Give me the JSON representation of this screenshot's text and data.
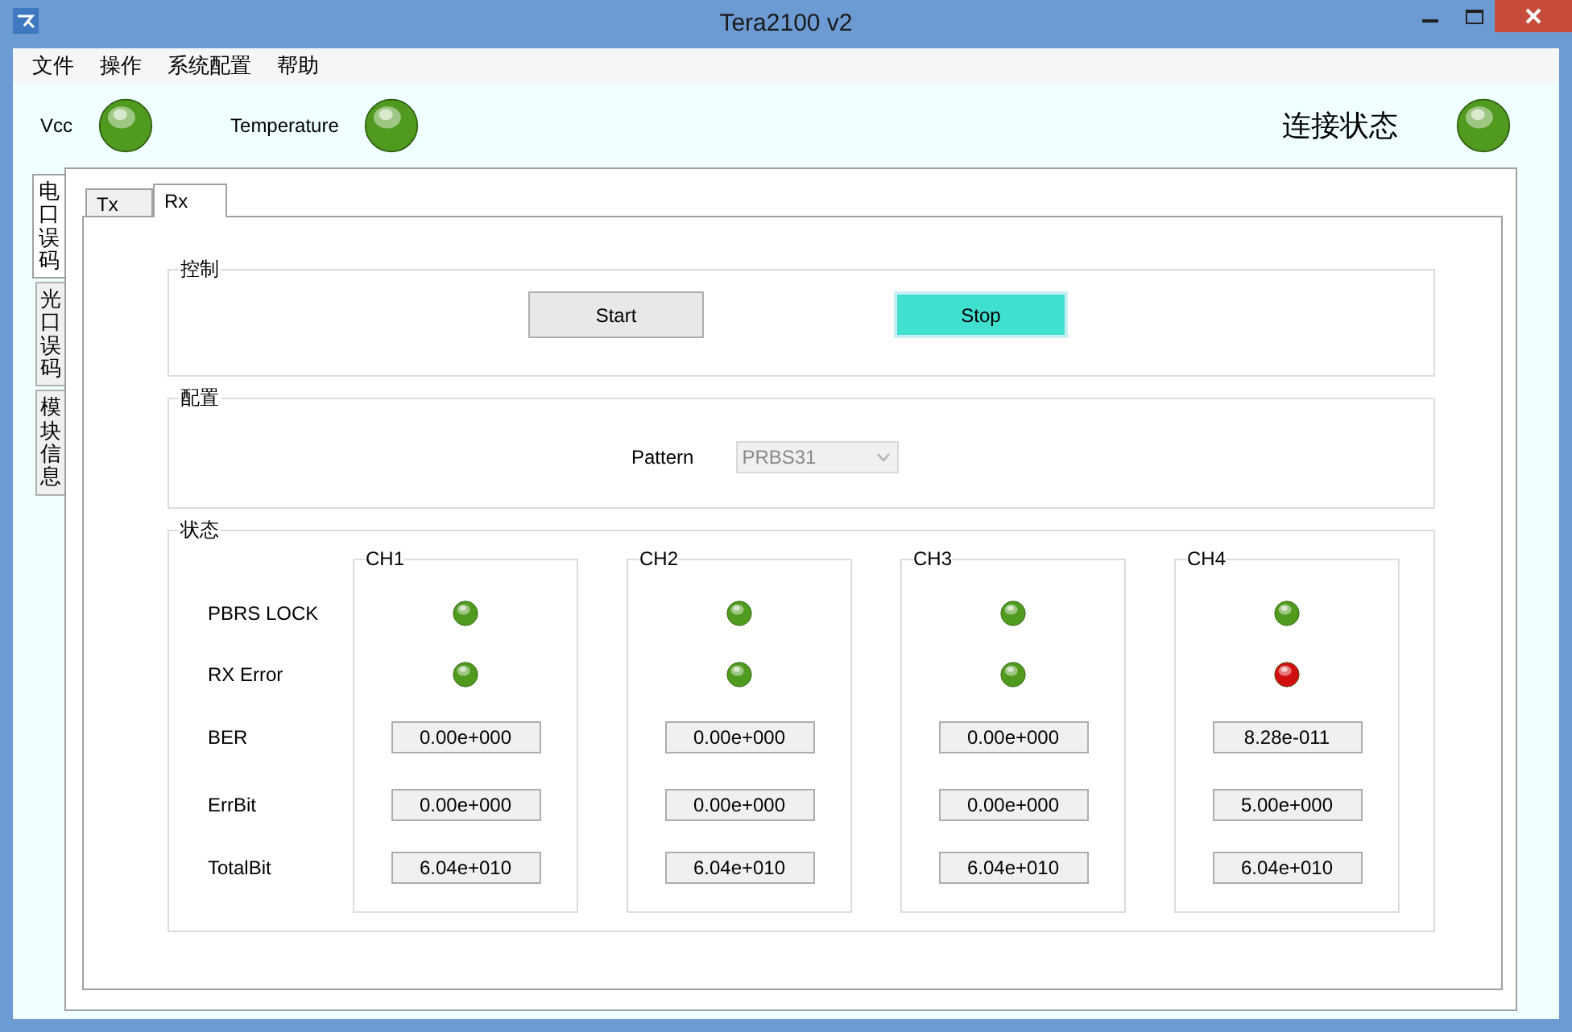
{
  "window": {
    "title": "Tera2100 v2"
  },
  "menu": [
    "文件",
    "操作",
    "系统配置",
    "帮助"
  ],
  "indicators": [
    {
      "label": "Vcc",
      "color": "#4f9a1f"
    },
    {
      "label": "Temperature",
      "color": "#4f9a1f"
    }
  ],
  "connection": {
    "label": "连接状态",
    "color": "#4f9a1f"
  },
  "side_tabs": [
    {
      "label": "电口误码",
      "selected": true
    },
    {
      "label": "光口误码",
      "selected": false
    },
    {
      "label": "模块信息",
      "selected": false
    }
  ],
  "tabs": [
    {
      "label": "Tx",
      "selected": false
    },
    {
      "label": "Rx",
      "selected": true
    }
  ],
  "control": {
    "title": "控制",
    "buttons": [
      {
        "label": "Start",
        "highlighted": false
      },
      {
        "label": "Stop",
        "highlighted": true
      }
    ]
  },
  "config": {
    "title": "配置",
    "pattern_label": "Pattern",
    "pattern": {
      "value": "PRBS31",
      "disabled": true
    }
  },
  "status": {
    "title": "状态",
    "row_labels": [
      "PBRS LOCK",
      "RX Error",
      "BER",
      "ErrBit",
      "TotalBit"
    ],
    "channels": [
      {
        "name": "CH1",
        "leds": [
          {
            "color": "#4f9a1f"
          },
          {
            "color": "#4f9a1f"
          }
        ],
        "ber": "0.00e+000",
        "errbit": "0.00e+000",
        "totalbit": "6.04e+010"
      },
      {
        "name": "CH2",
        "leds": [
          {
            "color": "#4f9a1f"
          },
          {
            "color": "#4f9a1f"
          }
        ],
        "ber": "0.00e+000",
        "errbit": "0.00e+000",
        "totalbit": "6.04e+010"
      },
      {
        "name": "CH3",
        "leds": [
          {
            "color": "#4f9a1f"
          },
          {
            "color": "#4f9a1f"
          }
        ],
        "ber": "0.00e+000",
        "errbit": "0.00e+000",
        "totalbit": "6.04e+010"
      },
      {
        "name": "CH4",
        "leds": [
          {
            "color": "#4f9a1f"
          },
          {
            "color": "#d01010"
          }
        ],
        "ber": "8.28e-011",
        "errbit": "5.00e+000",
        "totalbit": "6.04e+010"
      }
    ]
  }
}
